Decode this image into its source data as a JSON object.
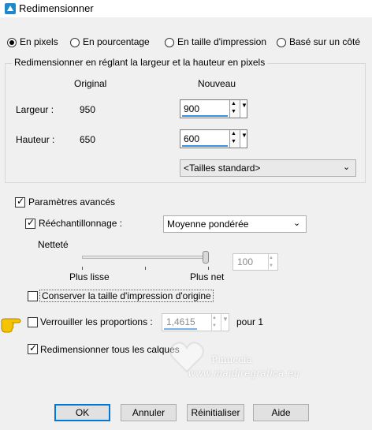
{
  "window": {
    "title": "Redimensionner"
  },
  "modes": [
    {
      "label": "En pixels",
      "selected": true
    },
    {
      "label": "En pourcentage",
      "selected": false
    },
    {
      "label": "En taille d'impression",
      "selected": false
    },
    {
      "label": "Basé sur un côté",
      "selected": false
    }
  ],
  "pixel_group": {
    "title": "Redimensionner en réglant la largeur et la hauteur en pixels",
    "col_original": "Original",
    "col_new": "Nouveau",
    "width": {
      "label": "Largeur :",
      "original": "950",
      "new": "900"
    },
    "height": {
      "label": "Hauteur :",
      "original": "650",
      "new": "600"
    },
    "preset": "<Tailles standard>"
  },
  "advanced": {
    "label": "Paramètres avancés",
    "checked": true,
    "resample": {
      "label": "Rééchantillonnage :",
      "checked": true,
      "method": "Moyenne pondérée"
    },
    "sharpness": {
      "label": "Netteté",
      "left": "Plus lisse",
      "right": "Plus net",
      "value": "100",
      "level_fraction": 1.0
    }
  },
  "keep_print_size": {
    "label": "Conserver la taille d'impression d'origine",
    "checked": false
  },
  "lock_ratio": {
    "label": "Verrouiller les proportions :",
    "checked": false,
    "value": "1,4615",
    "suffix": "pour 1"
  },
  "resize_all_layers": {
    "label": "Redimensionner tous les calques",
    "checked": true
  },
  "watermark": {
    "text": "Pinuccia",
    "url": "www.maidiregrafica.eu"
  },
  "buttons": {
    "ok": "OK",
    "cancel": "Annuler",
    "reset": "Réinitialiser",
    "help": "Aide"
  },
  "colors": {
    "accent": "#0078d7",
    "field_underline": "#3d8ee0",
    "background": "#f0f0f0"
  }
}
